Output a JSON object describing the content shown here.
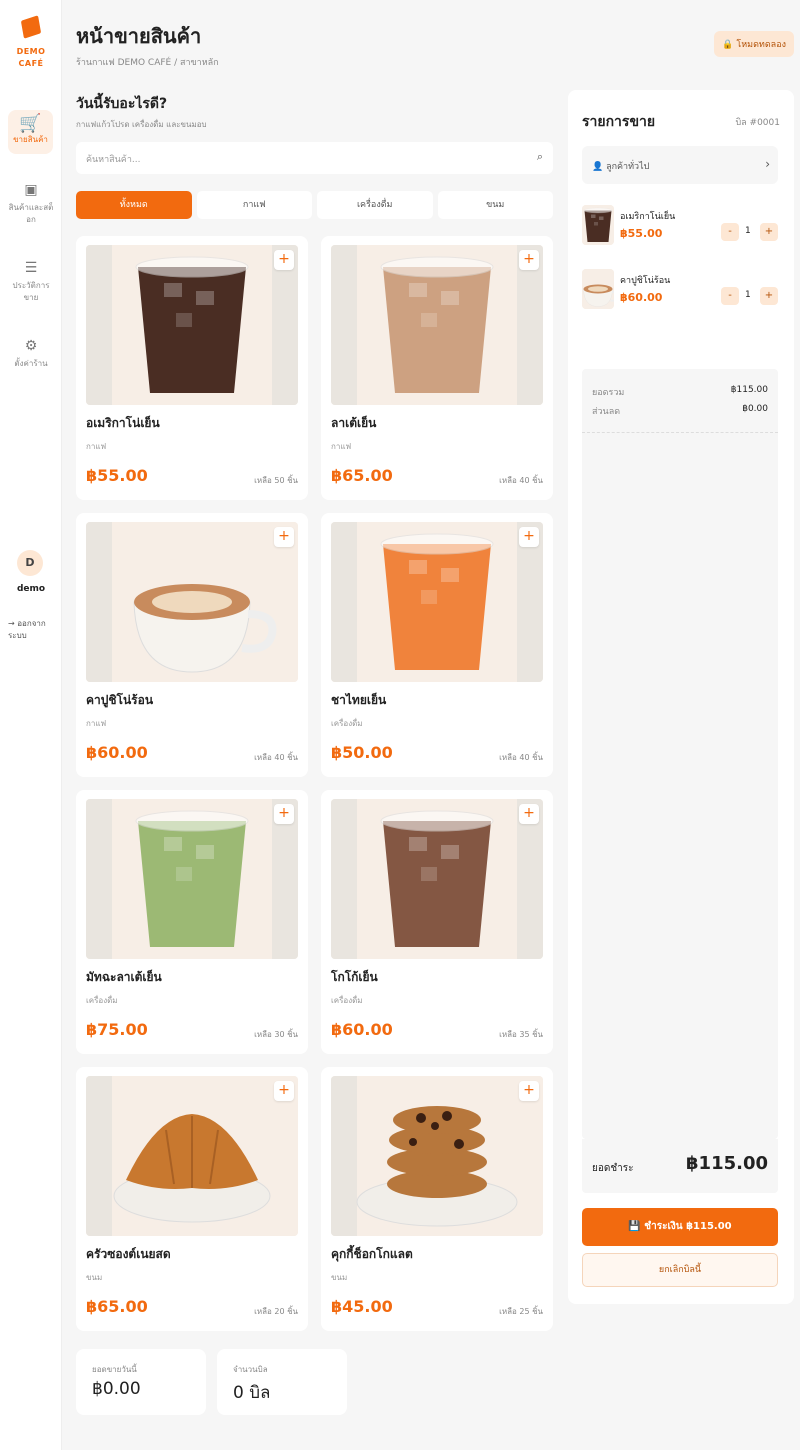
{
  "brand": {
    "line1": "DEMO",
    "line2": "CAFÉ"
  },
  "sidebar": {
    "items": [
      {
        "label": "ขายสินค้า",
        "icon": "cart-icon"
      },
      {
        "label": "สินค้าและสต็อก",
        "icon": "box-icon"
      },
      {
        "label": "ประวัติการขาย",
        "icon": "receipt-icon"
      },
      {
        "label": "ตั้งค่าร้าน",
        "icon": "gear-icon"
      }
    ],
    "avatar_initial": "D",
    "username": "demo",
    "logout_label": "→ ออกจากระบบ"
  },
  "header": {
    "title": "หน้าขายสินค้า",
    "breadcrumb": "ร้านกาแฟ DEMO CAFÉ / สาขาหลัก",
    "trial_badge": "🔒 โหมดทดลอง"
  },
  "catalog": {
    "heading": "วันนี้รับอะไรดี?",
    "subheading": "กาแฟแก้วโปรด เครื่องดื่ม และขนมอบ",
    "search_placeholder": "ค้นหาสินค้า...",
    "tabs": [
      "ทั้งหมด",
      "กาแฟ",
      "เครื่องดื่ม",
      "ขนม"
    ],
    "active_tab": "ทั้งหมด",
    "products": [
      {
        "name": "อเมริกาโน่เย็น",
        "category": "กาแฟ",
        "price": "฿55.00",
        "stock": "เหลือ 50 ชิ้น",
        "kind": "cup",
        "color": "#3b1c12"
      },
      {
        "name": "ลาเต้เย็น",
        "category": "กาแฟ",
        "price": "฿65.00",
        "stock": "เหลือ 40 ชิ้น",
        "kind": "cup",
        "color": "#c99a78"
      },
      {
        "name": "คาปูชิโน่ร้อน",
        "category": "กาแฟ",
        "price": "฿60.00",
        "stock": "เหลือ 40 ชิ้น",
        "kind": "mug",
        "color": "#c88b5d"
      },
      {
        "name": "ชาไทยเย็น",
        "category": "เครื่องดื่ม",
        "price": "฿50.00",
        "stock": "เหลือ 40 ชิ้น",
        "kind": "cup",
        "color": "#ef7a2e"
      },
      {
        "name": "มัทฉะลาเต้เย็น",
        "category": "เครื่องดื่ม",
        "price": "฿75.00",
        "stock": "เหลือ 30 ชิ้น",
        "kind": "cup",
        "color": "#94b46a"
      },
      {
        "name": "โกโก้เย็น",
        "category": "เครื่องดื่ม",
        "price": "฿60.00",
        "stock": "เหลือ 35 ชิ้น",
        "kind": "cup",
        "color": "#7a4a35"
      },
      {
        "name": "ครัวซองต์เนยสด",
        "category": "ขนม",
        "price": "฿65.00",
        "stock": "เหลือ 20 ชิ้น",
        "kind": "croissant",
        "color": "#c8782f"
      },
      {
        "name": "คุกกี้ช็อกโกแลต",
        "category": "ขนม",
        "price": "฿45.00",
        "stock": "เหลือ 25 ชิ้น",
        "kind": "cookie",
        "color": "#b7773c"
      }
    ]
  },
  "stats": [
    {
      "label": "ยอดขายวันนี้",
      "value": "฿0.00"
    },
    {
      "label": "จำนวนบิล",
      "value": "0 บิล"
    }
  ],
  "order": {
    "title": "รายการขาย",
    "bill_no": "บิล #0001",
    "customer": "👤 ลูกค้าทั่วไป",
    "lines": [
      {
        "name": "อเมริกาโน่เย็น",
        "price": "฿55.00",
        "qty": "1",
        "kind": "cup",
        "color": "#3b1c12"
      },
      {
        "name": "คาปูชิโน่ร้อน",
        "price": "฿60.00",
        "qty": "1",
        "kind": "mug",
        "color": "#c88b5d"
      }
    ],
    "subtotal_label": "ยอดรวม",
    "subtotal_value": "฿115.00",
    "discount_label": "ส่วนลด",
    "discount_value": "฿0.00",
    "total_label": "ยอดชำระ",
    "total_value": "฿115.00",
    "pay_label": "💾 ชำระเงิน ฿115.00",
    "cancel_label": "ยกเลิกบิลนี้"
  }
}
